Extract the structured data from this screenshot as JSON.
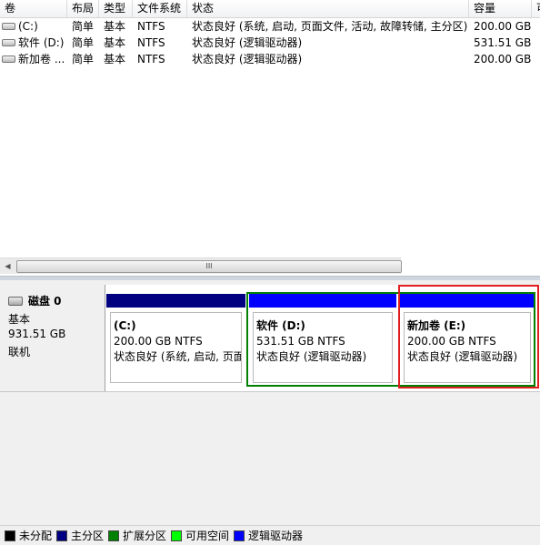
{
  "volume_list": {
    "columns": [
      "卷",
      "布局",
      "类型",
      "文件系统",
      "状态",
      "容量",
      "可"
    ],
    "rows": [
      {
        "volume": "(C:)",
        "layout": "简单",
        "type": "基本",
        "fs": "NTFS",
        "status": "状态良好 (系统, 启动, 页面文件, 活动, 故障转储, 主分区)",
        "capacity": "200.00 GB"
      },
      {
        "volume": "软件 (D:)",
        "layout": "简单",
        "type": "基本",
        "fs": "NTFS",
        "status": "状态良好 (逻辑驱动器)",
        "capacity": "531.51 GB"
      },
      {
        "volume": "新加卷 ...",
        "layout": "简单",
        "type": "基本",
        "fs": "NTFS",
        "status": "状态良好 (逻辑驱动器)",
        "capacity": "200.00 GB"
      }
    ],
    "scroll_thumb_glyph": "III"
  },
  "disk": {
    "name": "磁盘 0",
    "type": "基本",
    "size": "931.51 GB",
    "state": "联机",
    "partitions": [
      {
        "name": "(C:)",
        "size": "200.00 GB NTFS",
        "status": "状态良好 (系统, 启动, 页面",
        "bar_color": "#000080"
      },
      {
        "name": "软件  (D:)",
        "size": "531.51 GB NTFS",
        "status": "状态良好 (逻辑驱动器)",
        "bar_color": "#0000ff"
      },
      {
        "name": "新加卷  (E:)",
        "size": "200.00 GB NTFS",
        "status": "状态良好 (逻辑驱动器)",
        "bar_color": "#0000ff"
      }
    ]
  },
  "legend": [
    {
      "label": "未分配",
      "color": "#000000"
    },
    {
      "label": "主分区",
      "color": "#000080"
    },
    {
      "label": "扩展分区",
      "color": "#008000"
    },
    {
      "label": "可用空间",
      "color": "#00ff00"
    },
    {
      "label": "逻辑驱动器",
      "color": "#0000ff"
    }
  ],
  "colors": {
    "extended_outline": "#008000",
    "selection_outline": "#e02020"
  }
}
